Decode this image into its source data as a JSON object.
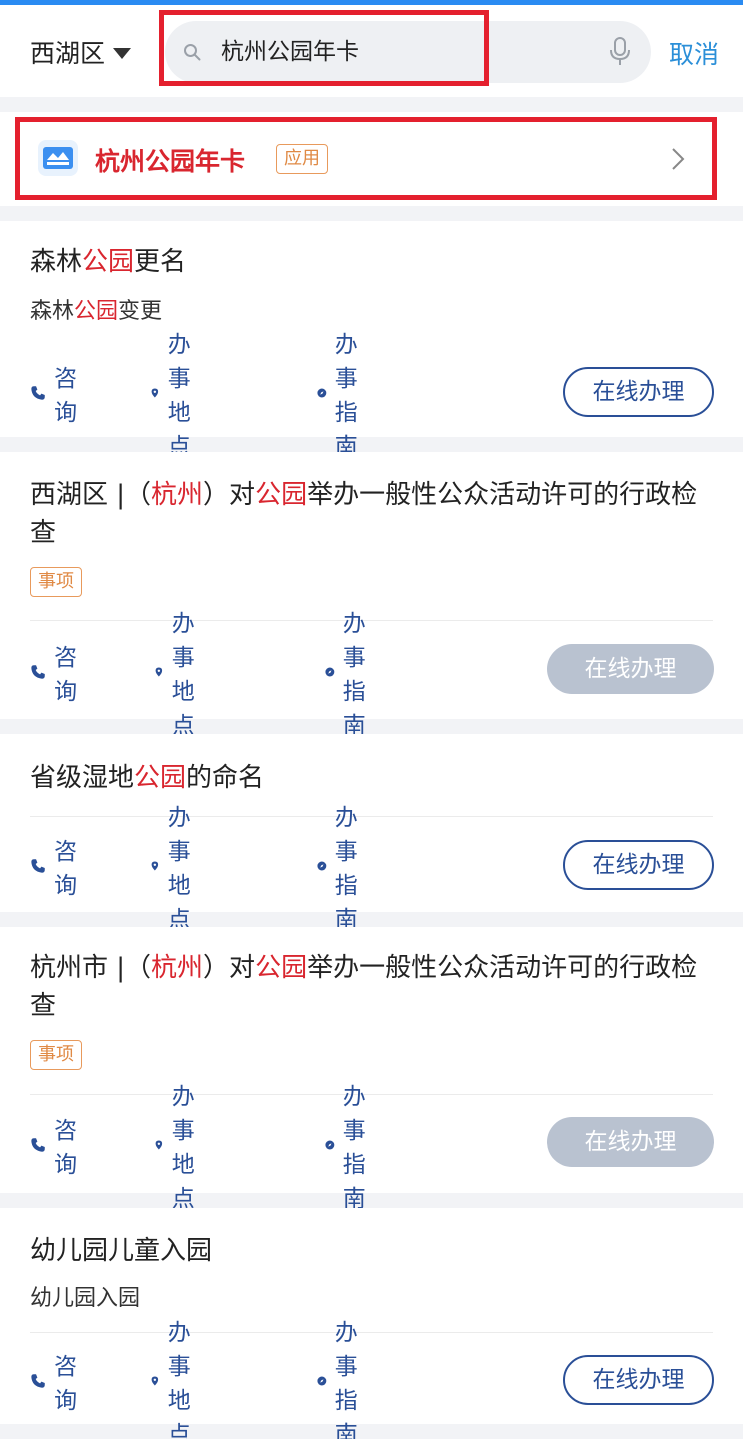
{
  "header": {
    "district": "西湖区",
    "search_value": "杭州公园年卡",
    "cancel_label": "取消"
  },
  "app_result": {
    "name": "杭州公园年卡",
    "tag": "应用"
  },
  "actions": {
    "consult": "咨询",
    "location": "办事地点",
    "guide": "办事指南",
    "online": "在线办理"
  },
  "results": [
    {
      "title_parts": [
        "森林",
        "公园",
        "更名"
      ],
      "sub_parts": [
        "森林",
        "公园",
        "变更"
      ],
      "online_enabled": true
    },
    {
      "title_parts": [
        "西湖区 |（",
        "杭州",
        "）对",
        "公园",
        "举办一般性公众活动许可的行政检查"
      ],
      "tag": "事项",
      "online_enabled": false
    },
    {
      "title_parts": [
        "省级湿地",
        "公园",
        "的命名"
      ],
      "online_enabled": true
    },
    {
      "title_parts": [
        "杭州市 |（",
        "杭州",
        "）对",
        "公园",
        "举办一般性公众活动许可的行政检查"
      ],
      "tag": "事项",
      "online_enabled": false
    },
    {
      "title": "幼儿园儿童入园",
      "sub": "幼儿园入园",
      "online_enabled": true
    }
  ],
  "colors": {
    "highlight": "#d9262f",
    "action_blue": "#2a4f97",
    "link_blue": "#2b8fd8",
    "tag_orange": "#e08a45",
    "annotation_red": "#e4202e",
    "disabled_gray": "#b9c2d0"
  },
  "icons": [
    "search-icon",
    "mic-icon",
    "app-card-icon",
    "chevron-right-icon",
    "phone-icon",
    "location-pin-icon",
    "compass-icon",
    "caret-down-icon"
  ]
}
